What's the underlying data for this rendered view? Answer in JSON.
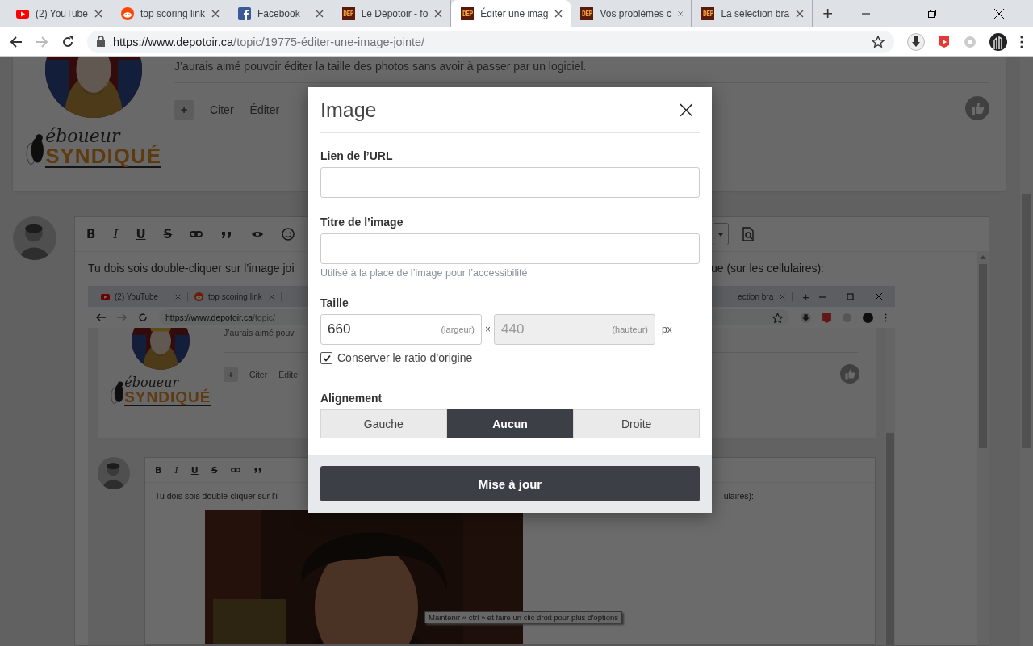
{
  "browser": {
    "tabs": [
      {
        "kind": "youtube",
        "title": "(2) YouTube",
        "selected": false
      },
      {
        "kind": "reddit",
        "title": "top scoring link",
        "selected": false
      },
      {
        "kind": "facebook",
        "title": "Facebook",
        "selected": false
      },
      {
        "kind": "dep",
        "badge": "DEP",
        "title": "Le Dépotoir - fo",
        "selected": false
      },
      {
        "kind": "dep",
        "badge": "DEP",
        "title": "Éditer une imag",
        "selected": true
      },
      {
        "kind": "dep",
        "badge": "DEP",
        "title": "Vos problèmes c",
        "selected": false
      },
      {
        "kind": "dep",
        "badge": "DEP",
        "title": "La sélection bra",
        "selected": false
      }
    ],
    "new_tab": "+",
    "url": {
      "host": "https://www.depotoir.ca",
      "path": "/topic/19775-éditer-une-image-jointe/"
    }
  },
  "page": {
    "first_post": {
      "text": "J’aurais aimé pouvoir éditer la taille des photos sans avoir à passer par un logiciel.",
      "add": "+",
      "actions": [
        "Citer",
        "Éditer"
      ],
      "logo": {
        "script": "éboueur",
        "bold": "SYNDIQUÉ"
      }
    },
    "editor": {
      "toolbar_left": [
        {
          "kind": "bold",
          "label": "B"
        },
        {
          "kind": "italic",
          "label": "I"
        },
        {
          "kind": "underline",
          "label": "U"
        },
        {
          "kind": "strike",
          "label": "S"
        },
        {
          "kind": "link"
        },
        {
          "kind": "quote"
        },
        {
          "kind": "eye"
        },
        {
          "kind": "emoji"
        }
      ],
      "toolbar_right": [
        {
          "kind": "dropdown"
        },
        {
          "kind": "preview"
        }
      ],
      "text_left": "Tu dois sois double-cliquer sur l’image joi",
      "text_right": "ue (sur les cellulaires):"
    },
    "embedded_screenshot": {
      "tabs_left": [
        {
          "kind": "youtube",
          "title": "(2) YouTube"
        },
        {
          "kind": "reddit",
          "title": "top scoring link"
        }
      ],
      "tabs_right": [
        {
          "title": "ection bra"
        }
      ],
      "new_tab": "+",
      "url": {
        "host": "https://www.depotoir.ca",
        "path": "/topic/"
      },
      "post_text": "J’aurais aimé pouv",
      "add": "+",
      "actions": [
        "Citer",
        "Édite"
      ],
      "logo": {
        "script": "éboueur",
        "bold": "SYNDIQUÉ"
      },
      "toolbar": [
        {
          "kind": "bold",
          "label": "B"
        },
        {
          "kind": "italic",
          "label": "I"
        },
        {
          "kind": "underline",
          "label": "U"
        },
        {
          "kind": "strike",
          "label": "S"
        },
        {
          "kind": "link"
        },
        {
          "kind": "quote"
        }
      ],
      "text_left": "Tu dois sois double-cliquer sur l’i",
      "text_right": "ulaires):",
      "photo": {
        "kind": "picture"
      },
      "tooltip": "Maintenir « ctrl » et faire un clic droit pour plus d’options"
    }
  },
  "dialog": {
    "title": "Image",
    "close": "×",
    "url_field": {
      "label": "Lien de l’URL"
    },
    "title_field": {
      "label": "Titre de l’image",
      "help": "Utilisé à la place de l’image pour l’accessibilité"
    },
    "size": {
      "label": "Taille",
      "width": {
        "value": "660",
        "suffix": "(largeur)",
        "disabled": false
      },
      "times": "×",
      "height": {
        "value": "440",
        "suffix": "(hauteur)",
        "disabled": true
      },
      "unit": "px"
    },
    "keep_ratio": {
      "label": "Conserver le ratio d’origine",
      "checked": true
    },
    "alignment": {
      "label": "Alignement",
      "options": [
        {
          "label": "Gauche",
          "selected": false
        },
        {
          "label": "Aucun",
          "selected": true
        },
        {
          "label": "Droite",
          "selected": false
        }
      ]
    },
    "submit": "Mise à jour"
  }
}
